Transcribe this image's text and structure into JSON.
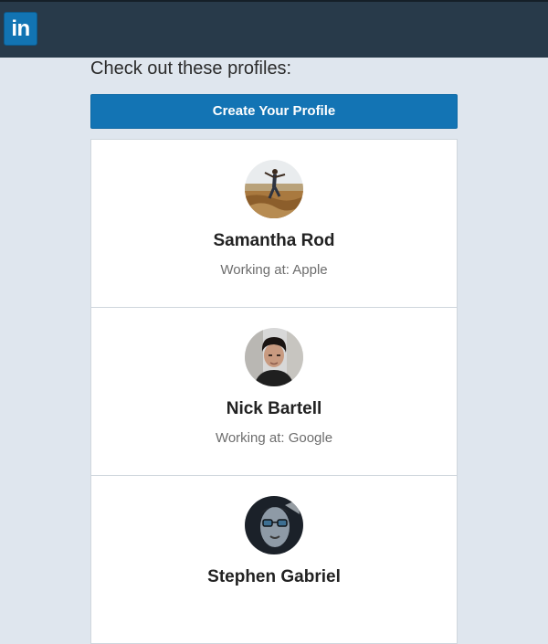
{
  "header": {
    "logo_text": "in",
    "colors": {
      "bar": "#283a4a",
      "logo": "#1274b3"
    }
  },
  "main": {
    "heading": "Check out these profiles:",
    "create_button_label": "Create Your Profile"
  },
  "profiles": [
    {
      "name": "Samantha Rod",
      "workplace": "Working at: Apple",
      "avatar_icon": "avatar-photo-person-jumping-beach"
    },
    {
      "name": "Nick Bartell",
      "workplace": "Working at: Google",
      "avatar_icon": "avatar-photo-man-dark-hair"
    },
    {
      "name": "Stephen Gabriel",
      "workplace": "",
      "avatar_icon": "avatar-photo-face-with-glasses"
    }
  ]
}
